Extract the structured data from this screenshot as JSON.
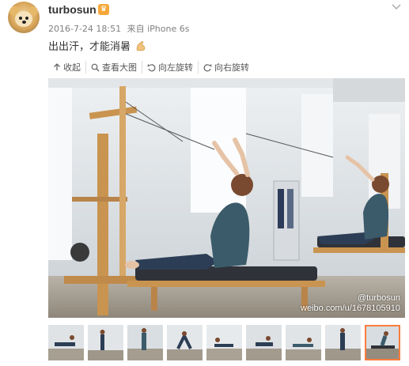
{
  "post": {
    "username": "turbosun",
    "badge_icon": "vip-crown-icon",
    "timestamp": "2016-7-24 18:51",
    "source": "来自 iPhone 6s",
    "text": "出出汗，才能消暑",
    "text_emoji": "flexed-biceps-icon"
  },
  "toolbar": {
    "collapse_label": "收起",
    "view_large_label": "查看大图",
    "rotate_left_label": "向左旋转",
    "rotate_right_label": "向右旋转"
  },
  "photo": {
    "watermark_handle": "@turbosun",
    "watermark_url": "weibo.com/u/1678105910"
  },
  "thumbnails": {
    "count": 9,
    "selected_index": 8
  },
  "colors": {
    "accent": "#fa7d3c",
    "meta_text": "#808080"
  }
}
